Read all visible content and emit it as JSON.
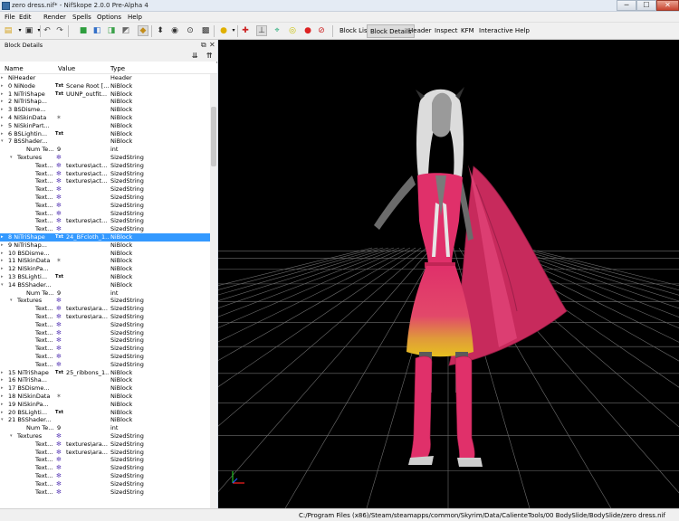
{
  "window": {
    "title": "zero dress.nif* - NifSkope 2.0.0 Pre-Alpha 4",
    "minimize": "─",
    "maximize": "☐",
    "close": "✕"
  },
  "menu": [
    "File",
    "Edit",
    "Render",
    "Spells",
    "Options",
    "Help"
  ],
  "toolbar": {
    "text_buttons": [
      "Block List",
      "Block Details",
      "Header",
      "Inspect",
      "KFM",
      "Interactive Help"
    ],
    "active": "Block Details"
  },
  "panel": {
    "title": "Block Details",
    "columns": [
      "Name",
      "Value",
      "Type"
    ],
    "rows": [
      {
        "depth": 0,
        "arrow": "▸",
        "name": "NiHeader",
        "value": "",
        "icon": "",
        "type": "Header"
      },
      {
        "depth": 0,
        "arrow": "▸",
        "name": "0 NiNode",
        "icon": "Txt",
        "value": "Scene Root [...",
        "type": "NiBlock"
      },
      {
        "depth": 0,
        "arrow": "▸",
        "name": "1 NiTriShape",
        "icon": "Txt",
        "value": "UUNP_outfit...",
        "type": "NiBlock"
      },
      {
        "depth": 0,
        "arrow": "▸",
        "name": "2 NiTriShap...",
        "icon": "",
        "value": "",
        "type": "NiBlock"
      },
      {
        "depth": 0,
        "arrow": "▸",
        "name": "3 BSDisme...",
        "icon": "",
        "value": "",
        "type": "NiBlock"
      },
      {
        "depth": 0,
        "arrow": "▸",
        "name": "4 NiSkinData",
        "icon": "✶",
        "value": "",
        "type": "NiBlock"
      },
      {
        "depth": 0,
        "arrow": "▸",
        "name": "5 NiSkinPart...",
        "icon": "",
        "value": "",
        "type": "NiBlock"
      },
      {
        "depth": 0,
        "arrow": "▸",
        "name": "6 BSLightin...",
        "icon": "Txt",
        "value": "",
        "type": "NiBlock"
      },
      {
        "depth": 0,
        "arrow": "▾",
        "name": "7 BSShader...",
        "icon": "",
        "value": "",
        "type": "NiBlock"
      },
      {
        "depth": 2,
        "arrow": "",
        "name": "Num Te...",
        "icon": "",
        "value": "9",
        "type": "int"
      },
      {
        "depth": 1,
        "arrow": "▾",
        "name": "Textures",
        "icon": "✻",
        "value": "",
        "type": "SizedString"
      },
      {
        "depth": 3,
        "arrow": "",
        "name": "Text...",
        "icon": "✻",
        "value": "textures\\act...",
        "type": "SizedString"
      },
      {
        "depth": 3,
        "arrow": "",
        "name": "Text...",
        "icon": "✻",
        "value": "textures\\act...",
        "type": "SizedString"
      },
      {
        "depth": 3,
        "arrow": "",
        "name": "Text...",
        "icon": "✻",
        "value": "textures\\act...",
        "type": "SizedString"
      },
      {
        "depth": 3,
        "arrow": "",
        "name": "Text...",
        "icon": "✻",
        "value": "",
        "type": "SizedString"
      },
      {
        "depth": 3,
        "arrow": "",
        "name": "Text...",
        "icon": "✻",
        "value": "",
        "type": "SizedString"
      },
      {
        "depth": 3,
        "arrow": "",
        "name": "Text...",
        "icon": "✻",
        "value": "",
        "type": "SizedString"
      },
      {
        "depth": 3,
        "arrow": "",
        "name": "Text...",
        "icon": "✻",
        "value": "",
        "type": "SizedString"
      },
      {
        "depth": 3,
        "arrow": "",
        "name": "Text...",
        "icon": "✻",
        "value": "textures\\act...",
        "type": "SizedString"
      },
      {
        "depth": 3,
        "arrow": "",
        "name": "Text...",
        "icon": "✻",
        "value": "",
        "type": "SizedString"
      },
      {
        "depth": 0,
        "arrow": "▸",
        "name": "8 NiTriShape",
        "icon": "Txt",
        "value": "24_BFcloth_1...",
        "type": "NiBlock",
        "selected": true
      },
      {
        "depth": 0,
        "arrow": "▸",
        "name": "9 NiTriShap...",
        "icon": "",
        "value": "",
        "type": "NiBlock"
      },
      {
        "depth": 0,
        "arrow": "▸",
        "name": "10 BSDisme...",
        "icon": "",
        "value": "",
        "type": "NiBlock"
      },
      {
        "depth": 0,
        "arrow": "▸",
        "name": "11 NiSkinData",
        "icon": "✶",
        "value": "",
        "type": "NiBlock"
      },
      {
        "depth": 0,
        "arrow": "▸",
        "name": "12 NiSkinPa...",
        "icon": "",
        "value": "",
        "type": "NiBlock"
      },
      {
        "depth": 0,
        "arrow": "▸",
        "name": "13 BSLighti...",
        "icon": "Txt",
        "value": "",
        "type": "NiBlock"
      },
      {
        "depth": 0,
        "arrow": "▾",
        "name": "14 BSShader...",
        "icon": "",
        "value": "",
        "type": "NiBlock"
      },
      {
        "depth": 2,
        "arrow": "",
        "name": "Num Te...",
        "icon": "",
        "value": "9",
        "type": "int"
      },
      {
        "depth": 1,
        "arrow": "▾",
        "name": "Textures",
        "icon": "✻",
        "value": "",
        "type": "SizedString"
      },
      {
        "depth": 3,
        "arrow": "",
        "name": "Text...",
        "icon": "✻",
        "value": "textures\\ara...",
        "type": "SizedString"
      },
      {
        "depth": 3,
        "arrow": "",
        "name": "Text...",
        "icon": "✻",
        "value": "textures\\ara...",
        "type": "SizedString"
      },
      {
        "depth": 3,
        "arrow": "",
        "name": "Text...",
        "icon": "✻",
        "value": "",
        "type": "SizedString"
      },
      {
        "depth": 3,
        "arrow": "",
        "name": "Text...",
        "icon": "✻",
        "value": "",
        "type": "SizedString"
      },
      {
        "depth": 3,
        "arrow": "",
        "name": "Text...",
        "icon": "✻",
        "value": "",
        "type": "SizedString"
      },
      {
        "depth": 3,
        "arrow": "",
        "name": "Text...",
        "icon": "✻",
        "value": "",
        "type": "SizedString"
      },
      {
        "depth": 3,
        "arrow": "",
        "name": "Text...",
        "icon": "✻",
        "value": "",
        "type": "SizedString"
      },
      {
        "depth": 3,
        "arrow": "",
        "name": "Text...",
        "icon": "✻",
        "value": "",
        "type": "SizedString"
      },
      {
        "depth": 0,
        "arrow": "▸",
        "name": "15 NiTriShape",
        "icon": "Txt",
        "value": "25_ribbons_1...",
        "type": "NiBlock"
      },
      {
        "depth": 0,
        "arrow": "▸",
        "name": "16 NiTriSha...",
        "icon": "",
        "value": "",
        "type": "NiBlock"
      },
      {
        "depth": 0,
        "arrow": "▸",
        "name": "17 BSDisme...",
        "icon": "",
        "value": "",
        "type": "NiBlock"
      },
      {
        "depth": 0,
        "arrow": "▸",
        "name": "18 NiSkinData",
        "icon": "✶",
        "value": "",
        "type": "NiBlock"
      },
      {
        "depth": 0,
        "arrow": "▸",
        "name": "19 NiSkinPa...",
        "icon": "",
        "value": "",
        "type": "NiBlock"
      },
      {
        "depth": 0,
        "arrow": "▸",
        "name": "20 BSLighti...",
        "icon": "Txt",
        "value": "",
        "type": "NiBlock"
      },
      {
        "depth": 0,
        "arrow": "▾",
        "name": "21 BSShader...",
        "icon": "",
        "value": "",
        "type": "NiBlock"
      },
      {
        "depth": 2,
        "arrow": "",
        "name": "Num Te...",
        "icon": "",
        "value": "9",
        "type": "int"
      },
      {
        "depth": 1,
        "arrow": "▾",
        "name": "Textures",
        "icon": "✻",
        "value": "",
        "type": "SizedString"
      },
      {
        "depth": 3,
        "arrow": "",
        "name": "Text...",
        "icon": "✻",
        "value": "textures\\ara...",
        "type": "SizedString"
      },
      {
        "depth": 3,
        "arrow": "",
        "name": "Text...",
        "icon": "✻",
        "value": "textures\\ara...",
        "type": "SizedString"
      },
      {
        "depth": 3,
        "arrow": "",
        "name": "Text...",
        "icon": "✻",
        "value": "",
        "type": "SizedString"
      },
      {
        "depth": 3,
        "arrow": "",
        "name": "Text...",
        "icon": "✻",
        "value": "",
        "type": "SizedString"
      },
      {
        "depth": 3,
        "arrow": "",
        "name": "Text...",
        "icon": "✻",
        "value": "",
        "type": "SizedString"
      },
      {
        "depth": 3,
        "arrow": "",
        "name": "Text...",
        "icon": "✻",
        "value": "",
        "type": "SizedString"
      },
      {
        "depth": 3,
        "arrow": "",
        "name": "Text...",
        "icon": "✻",
        "value": "",
        "type": "SizedString"
      }
    ]
  },
  "statusbar": {
    "path": "C:/Program Files (x86)/Steam/steamapps/common/Skyrim/Data/CalienteTools/00 BodySlide/BodySlide/zero dress.nif"
  },
  "colors": {
    "selection": "#3399ff",
    "viewport_bg": "#000000",
    "dress": "#e0306a",
    "grid": "#7a7a7a"
  }
}
